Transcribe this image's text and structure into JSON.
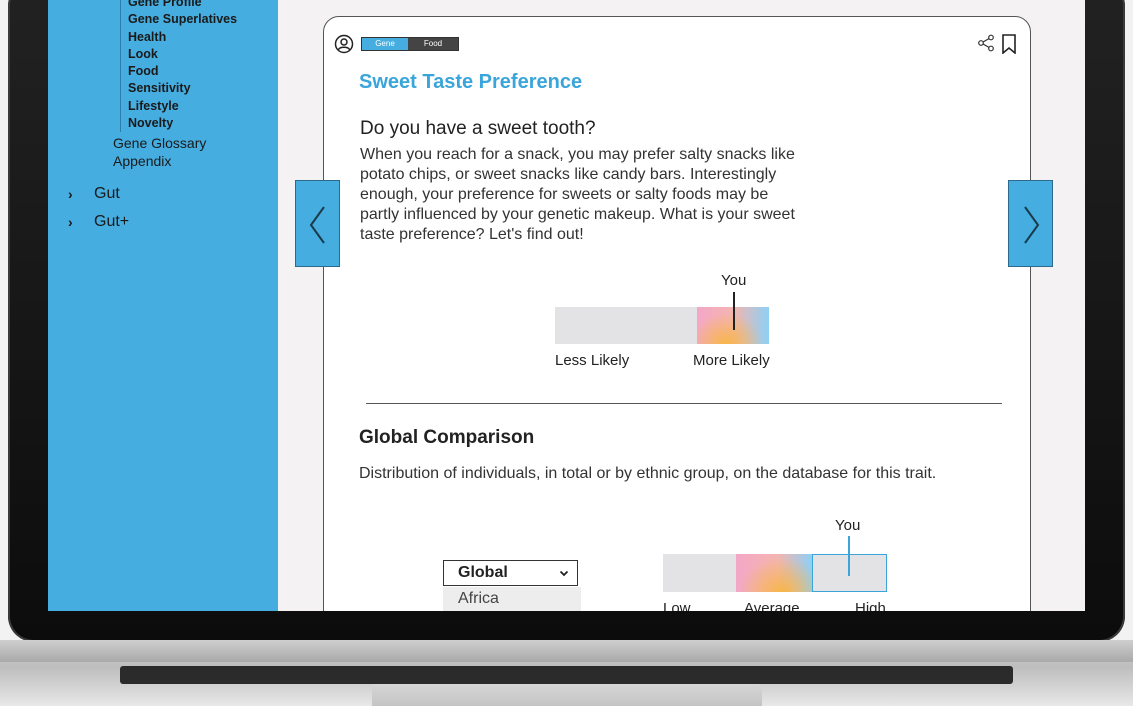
{
  "sidebar": {
    "subnav_items": [
      "Gene Profile",
      "Gene Superlatives",
      "Health",
      "Look",
      "Food",
      "Sensitivity",
      "Lifestyle",
      "Novelty"
    ],
    "level2_items": [
      "Gene Glossary",
      "Appendix"
    ],
    "top_items": [
      "Gut",
      "Gut+"
    ],
    "top_chevron": "›"
  },
  "card": {
    "tags": [
      "Gene",
      "Food"
    ],
    "title": "Sweet Taste Preference",
    "question": "Do you have a sweet tooth?",
    "body": "When you reach for a snack, you may prefer salty snacks like potato chips, or sweet snacks like candy bars. Interestingly enough, your preference for sweets or salty foods may be partly influenced by your genetic makeup. What is your sweet taste preference? Let's find out!",
    "result_scale": {
      "you_label": "You",
      "low_label": "Less Likely",
      "high_label": "More Likely"
    },
    "global": {
      "title": "Global Comparison",
      "description": "Distribution of individuals, in total or by ethnic group, on the database for this trait.",
      "select_value": "Global",
      "select_option": "Africa",
      "you_label": "You",
      "scale_labels": [
        "Low",
        "Average",
        "High"
      ]
    }
  },
  "colors": {
    "accent": "#45ade0",
    "title_blue": "#3aa5da",
    "tag_dark": "#444444"
  },
  "icons": {
    "avatar": "user-circle-icon",
    "share": "share-icon",
    "bookmark": "bookmark-icon",
    "prev": "chevron-left-icon",
    "next": "chevron-right-icon",
    "select": "chevron-down-icon"
  }
}
